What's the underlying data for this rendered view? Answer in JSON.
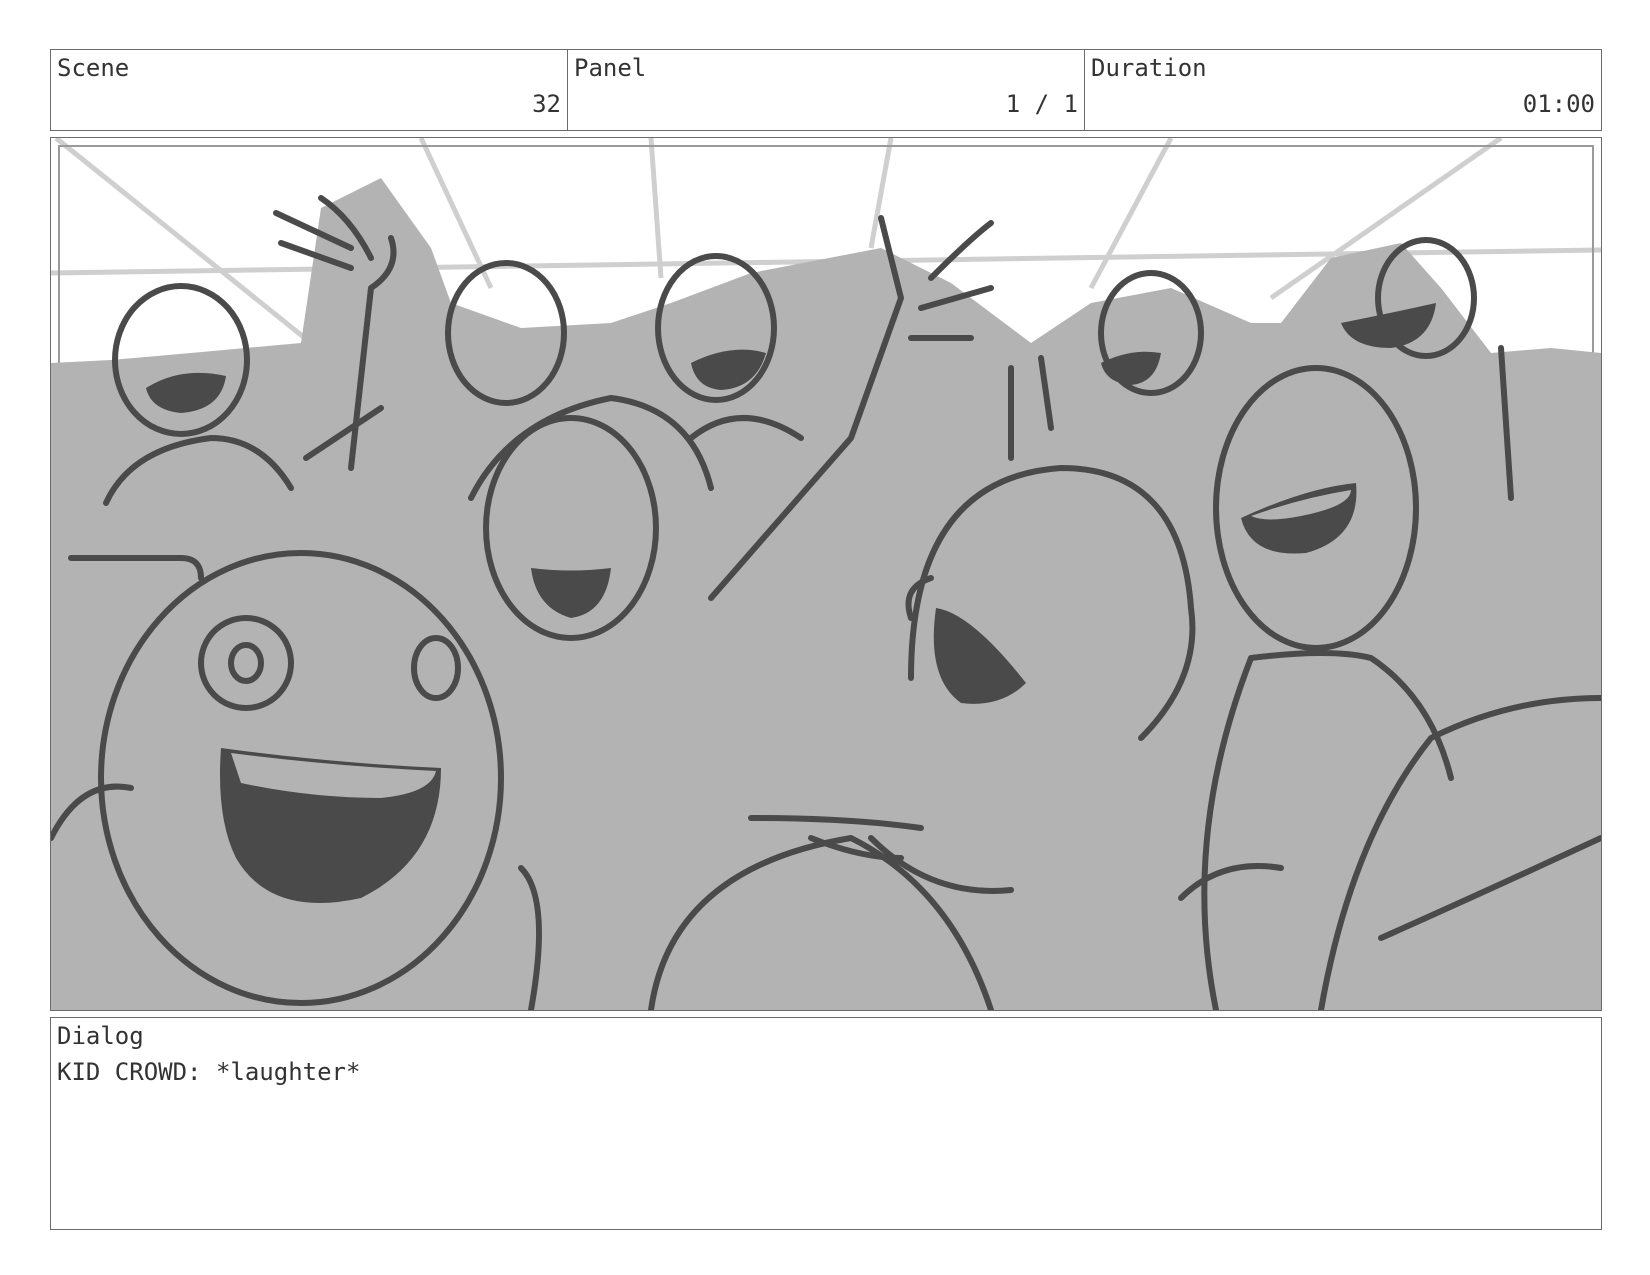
{
  "header": {
    "scene_label": "Scene",
    "scene_value": "32",
    "panel_label": "Panel",
    "panel_value": "1 / 1",
    "duration_label": "Duration",
    "duration_value": "01:00"
  },
  "dialog": {
    "label": "Dialog",
    "text": "KID CROWD: *laughter*"
  },
  "colors": {
    "fill": "#b3b3b3",
    "ink": "#4a4a4a",
    "guide": "#cfcfcf",
    "border": "#6b6b6b"
  }
}
